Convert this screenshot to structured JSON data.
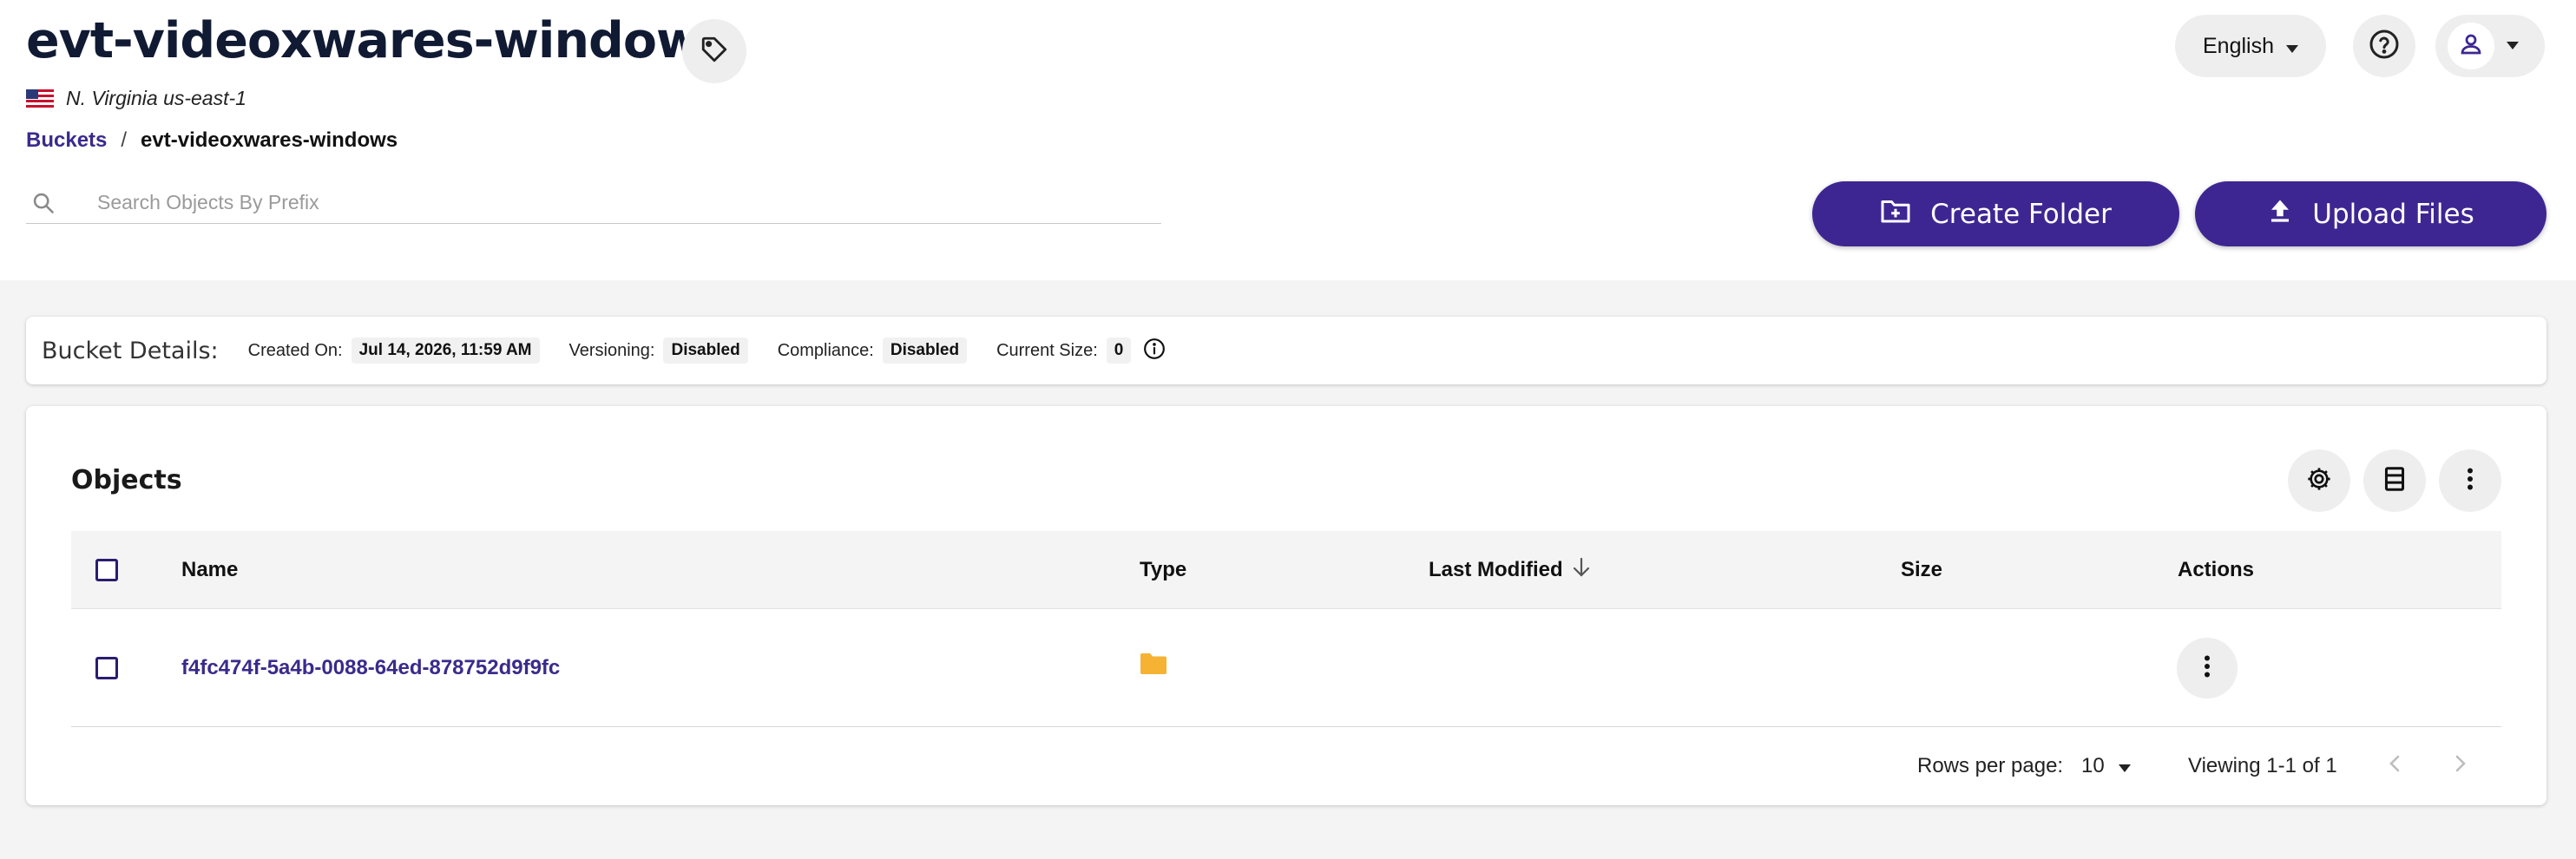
{
  "bucket": {
    "name": "evt-videoxwares-windows",
    "region": "N. Virginia us-east-1"
  },
  "header": {
    "language": "English"
  },
  "breadcrumb": {
    "root": "Buckets",
    "separator": "/",
    "current": "evt-videoxwares-windows"
  },
  "search": {
    "placeholder": "Search Objects By Prefix",
    "value": ""
  },
  "actions": {
    "create_folder": "Create Folder",
    "upload_files": "Upload Files"
  },
  "details": {
    "title": "Bucket Details:",
    "created_label": "Created On:",
    "created_value": "Jul 14, 2026, 11:59 AM",
    "versioning_label": "Versioning:",
    "versioning_value": "Disabled",
    "compliance_label": "Compliance:",
    "compliance_value": "Disabled",
    "size_label": "Current Size:",
    "size_value": "0"
  },
  "objects": {
    "title": "Objects",
    "columns": {
      "name": "Name",
      "type": "Type",
      "last_modified": "Last Modified",
      "size": "Size",
      "actions": "Actions"
    },
    "rows": [
      {
        "name": "f4fc474f-5a4b-0088-64ed-878752d9f9fc",
        "type_icon": "folder-icon",
        "last_modified": "",
        "size": ""
      }
    ]
  },
  "pagination": {
    "rows_per_page_label": "Rows per page:",
    "rows_per_page": "10",
    "viewing": "Viewing 1-1 of 1"
  },
  "colors": {
    "primary": "#3e2692",
    "link": "#3b2a8c",
    "folder": "#f5b233",
    "page_bg": "#f4f4f4"
  }
}
